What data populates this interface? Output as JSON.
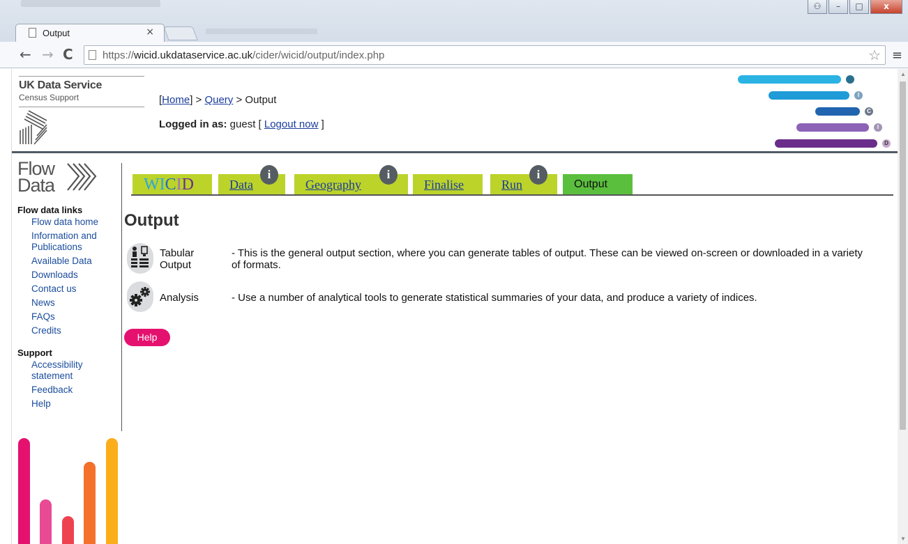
{
  "browser": {
    "tab_title": "Output",
    "tab_close": "×",
    "url_prefix": "https://",
    "url_domain": "wicid.ukdataservice.ac.uk",
    "url_path": "/cider/wicid/output/index.php",
    "back": "←",
    "forward": "→",
    "reload": "C",
    "star": "☆",
    "menu": "≡",
    "minimize": "–",
    "maximize": "□",
    "close": "x"
  },
  "header": {
    "brand_name": "UK Data Service",
    "brand_sub": "Census Support",
    "crumb_open": "[",
    "crumb_home": "Home",
    "crumb_sep1": "] > ",
    "crumb_query": "Query",
    "crumb_sep2": " > Output",
    "login_label": "Logged in as:",
    "login_user": " guest [ ",
    "logout": "Logout now",
    "login_close": " ]",
    "dot_letters": [
      "",
      "I",
      "C",
      "I",
      "D"
    ]
  },
  "sidebar": {
    "flow_word1": "Flow",
    "flow_word2": "Data",
    "flow_heading": "Flow data links",
    "flow_links": [
      "Flow data home",
      "Information and Publications",
      "Available Data",
      "Downloads",
      "Contact us",
      "News",
      "FAQs",
      "Credits"
    ],
    "support_heading": "Support",
    "support_links": [
      "Accessibility statement",
      "Feedback",
      "Help"
    ]
  },
  "tabs": {
    "wicid_letters": [
      "W",
      "I",
      "C",
      "I",
      "D"
    ],
    "wicid_colors": [
      "#2aa7e0",
      "#2aa7e0",
      "#1f6fb8",
      "#9e6cc0",
      "#6a2d8c"
    ],
    "data": "Data",
    "geography": "Geography",
    "finalise": "Finalise",
    "run": "Run",
    "output": "Output",
    "info_glyph": "i"
  },
  "content": {
    "title": "Output",
    "options": [
      {
        "name": "Tabular Output",
        "desc": "- This is the general output section, where you can generate tables of output. These can be viewed on-screen or downloaded in a variety of formats."
      },
      {
        "name": "Analysis",
        "desc": "- Use a number of analytical tools to generate statistical summaries of your data, and produce a variety of indices."
      }
    ],
    "help": "Help"
  },
  "colors": {
    "tab_green": "#bcd32a",
    "active_tab": "#5bbf3e",
    "help_pink": "#e5116f",
    "bars": [
      "#e5116f",
      "#e84a94",
      "#ef4250",
      "#f4712b",
      "#fbae1b"
    ],
    "header_bars": [
      "#2bb3e4",
      "#1f9bd7",
      "#2164b0",
      "#8c63b6",
      "#6a2d8c"
    ]
  }
}
